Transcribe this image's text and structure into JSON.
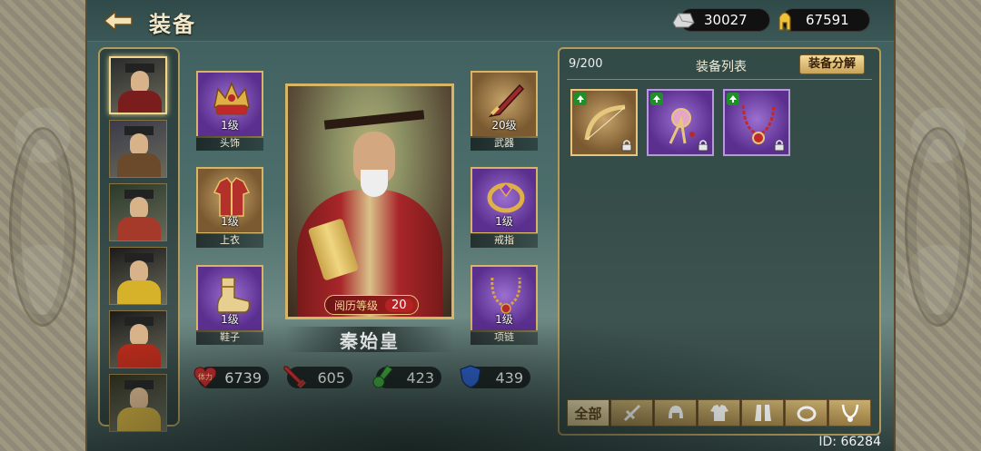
{
  "header": {
    "title": "装备",
    "back_icon": "back-arrow-icon",
    "currencies": [
      {
        "icon": "silver-ingot-icon",
        "value": "30027"
      },
      {
        "icon": "gold-coin-icon",
        "value": "67591"
      }
    ]
  },
  "roster": [
    {
      "name": "hero-portrait-1",
      "active": true,
      "colors": [
        "#2b2b2b",
        "#7a1d1d"
      ]
    },
    {
      "name": "hero-portrait-2",
      "active": false,
      "colors": [
        "#3a3a4a",
        "#6a4a2a"
      ]
    },
    {
      "name": "hero-portrait-3",
      "active": false,
      "colors": [
        "#2a3a2a",
        "#a53a2a"
      ]
    },
    {
      "name": "hero-portrait-4",
      "active": false,
      "colors": [
        "#1a1a1a",
        "#d6b22a"
      ]
    },
    {
      "name": "hero-portrait-5",
      "active": false,
      "colors": [
        "#1a1a1a",
        "#b52a1a"
      ]
    },
    {
      "name": "hero-portrait-6",
      "active": false,
      "colors": [
        "#2a2a1a",
        "#c9a53a"
      ]
    }
  ],
  "slots": {
    "headwear": {
      "level": "1级",
      "label": "头饰",
      "quality": "purple"
    },
    "armor": {
      "level": "1级",
      "label": "上衣",
      "quality": "gold"
    },
    "boots": {
      "level": "1级",
      "label": "鞋子",
      "quality": "purple"
    },
    "weapon": {
      "level": "20级",
      "label": "武器",
      "quality": "gold"
    },
    "ring": {
      "level": "1级",
      "label": "戒指",
      "quality": "purple"
    },
    "necklace": {
      "level": "1级",
      "label": "项链",
      "quality": "purple"
    }
  },
  "hero": {
    "name": "秦始皇",
    "exp_label": "阅历等级",
    "exp_level": "20"
  },
  "stats": {
    "hp": {
      "icon": "hp-icon",
      "value": "6739",
      "icon_text": "体力"
    },
    "attack": {
      "icon": "sword-attack-icon",
      "value": "605"
    },
    "agility": {
      "icon": "boot-speed-icon",
      "value": "423"
    },
    "defense": {
      "icon": "shield-defense-icon",
      "value": "439"
    }
  },
  "inventory": {
    "count": "9/200",
    "title": "装备列表",
    "decompose_label": "装备分解",
    "items": [
      {
        "name": "bow-item",
        "quality": "gold"
      },
      {
        "name": "hairpin-item",
        "quality": "purple"
      },
      {
        "name": "pendant-necklace-item",
        "quality": "purple"
      }
    ],
    "filters": [
      {
        "name": "filter-all",
        "label": "全部",
        "active": true
      },
      {
        "name": "filter-weapon",
        "icon": "sword-icon"
      },
      {
        "name": "filter-helmet",
        "icon": "helmet-icon"
      },
      {
        "name": "filter-armor",
        "icon": "armor-icon"
      },
      {
        "name": "filter-boots",
        "icon": "boots-icon"
      },
      {
        "name": "filter-ring",
        "icon": "ring-icon"
      },
      {
        "name": "filter-necklace",
        "icon": "necklace-icon"
      }
    ]
  },
  "player_id": "ID: 66284"
}
